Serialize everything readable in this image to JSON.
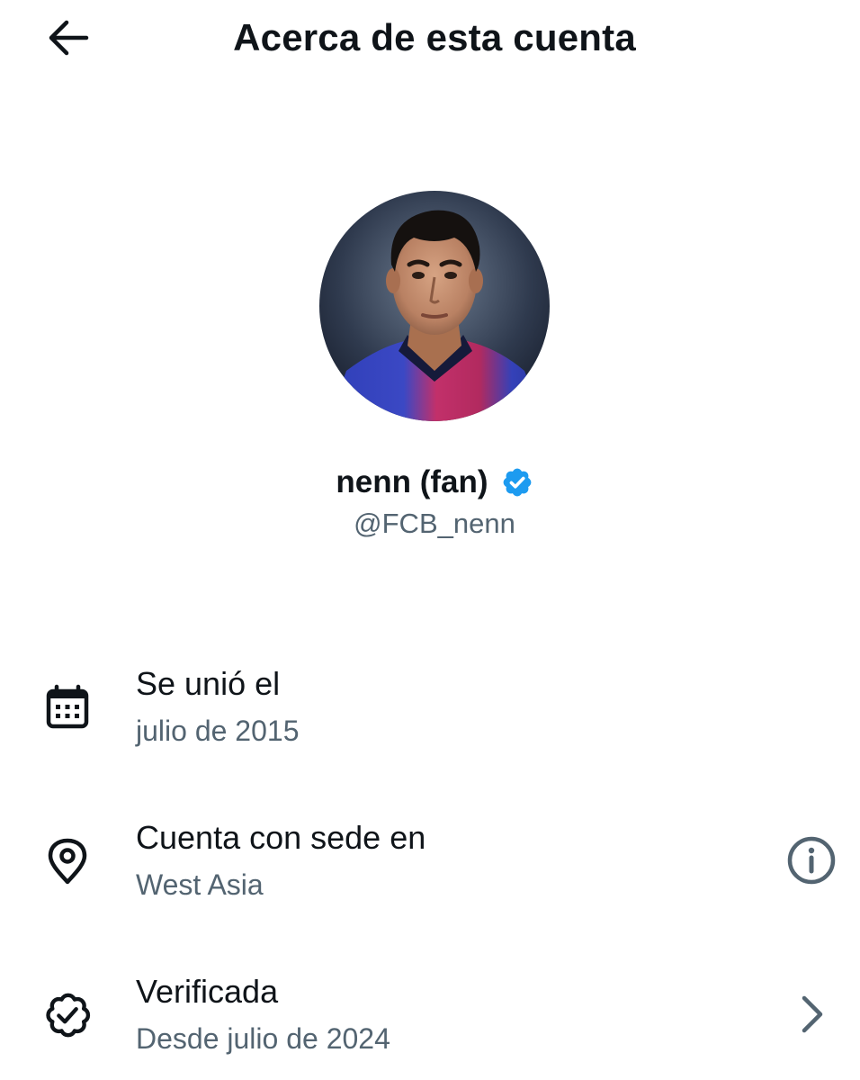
{
  "header": {
    "back_icon": "arrow-left-icon",
    "title": "Acerca de esta cuenta"
  },
  "profile": {
    "display_name": "nenn (fan)",
    "verified_icon": "verified-badge-icon",
    "verified_color": "#1d9bf0",
    "handle": "@FCB_nenn"
  },
  "details": [
    {
      "icon": "calendar-icon",
      "title": "Se unió el",
      "value": "julio de 2015"
    },
    {
      "icon": "location-pin-icon",
      "title": "Cuenta con sede en",
      "value": "West Asia",
      "action_icon": "info-icon"
    },
    {
      "icon": "verified-outline-icon",
      "title": "Verificada",
      "value": "Desde julio de 2024",
      "action_icon": "chevron-right-icon"
    }
  ],
  "colors": {
    "text_primary": "#0f1419",
    "text_secondary": "#536471",
    "accent": "#1d9bf0"
  }
}
